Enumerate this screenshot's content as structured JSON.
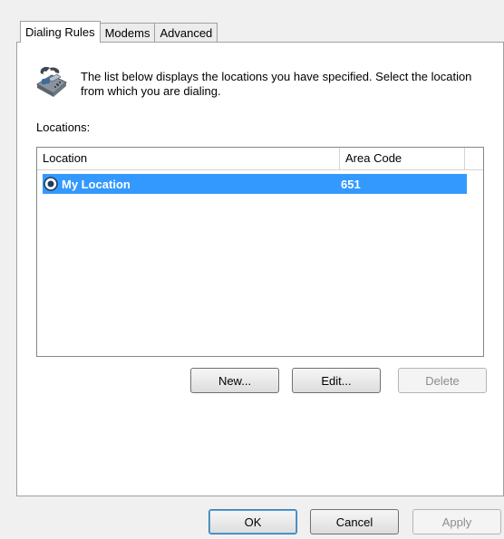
{
  "tabs": [
    {
      "label": "Dialing Rules",
      "active": true
    },
    {
      "label": "Modems",
      "active": false
    },
    {
      "label": "Advanced",
      "active": false
    }
  ],
  "info": {
    "icon": "telephone-icon",
    "text": "The list below displays the locations you have specified. Select the location from which you are dialing."
  },
  "locations": {
    "label": "Locations:",
    "columns": [
      "Location",
      "Area Code"
    ],
    "rows": [
      {
        "location": "My Location",
        "area_code": "651",
        "selected": true,
        "current_icon": "check-circle-icon"
      }
    ]
  },
  "list_buttons": {
    "new": "New...",
    "edit": "Edit...",
    "delete": "Delete"
  },
  "dialog_buttons": {
    "ok": "OK",
    "cancel": "Cancel",
    "apply": "Apply"
  },
  "colors": {
    "selection": "#3399ff",
    "panel_border": "#a0a0a0"
  }
}
